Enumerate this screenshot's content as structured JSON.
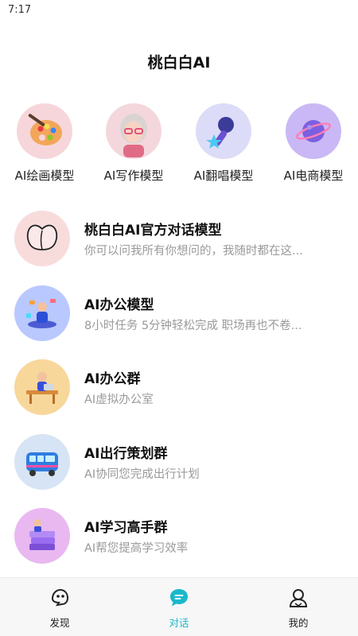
{
  "status_bar": {
    "time": "7:17"
  },
  "header": {
    "title": "桃白白AI"
  },
  "models": [
    {
      "label": "AI绘画模型",
      "icon": "palette-icon"
    },
    {
      "label": "AI写作模型",
      "icon": "writer-avatar-icon"
    },
    {
      "label": "AI翻唱模型",
      "icon": "microphone-icon"
    },
    {
      "label": "AI电商模型",
      "icon": "planet-icon"
    }
  ],
  "chats": [
    {
      "name": "桃白白AI官方对话模型",
      "desc": "你可以问我所有你想问的，我随时都在这...",
      "icon": "peach-icon"
    },
    {
      "name": "AI办公模型",
      "desc": "8小时任务 5分钟轻松完成 职场再也不卷...",
      "icon": "office-worker-icon"
    },
    {
      "name": "AI办公群",
      "desc": "AI虚拟办公室",
      "icon": "office-desk-icon"
    },
    {
      "name": "AI出行策划群",
      "desc": "AI协同您完成出行计划",
      "icon": "bus-icon"
    },
    {
      "name": "AI学习高手群",
      "desc": "AI帮您提高学习效率",
      "icon": "books-icon"
    }
  ],
  "tabs": [
    {
      "label": "发现",
      "icon": "discover-icon",
      "active": false
    },
    {
      "label": "对话",
      "icon": "chat-bubble-icon",
      "active": true
    },
    {
      "label": "我的",
      "icon": "profile-icon",
      "active": false
    }
  ],
  "colors": {
    "accent": "#1bb8c9",
    "muted_text": "#9a9a9a",
    "tab_bar_bg": "#f7f7f7"
  }
}
